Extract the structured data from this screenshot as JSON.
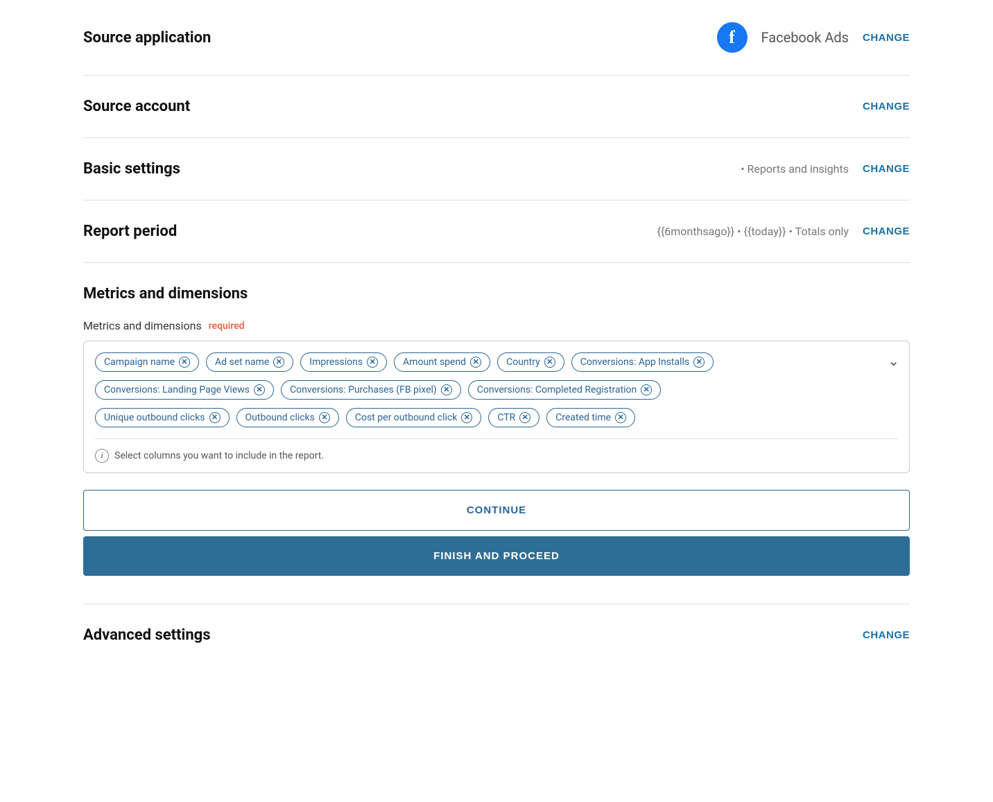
{
  "sourceApplication": {
    "title": "Source application",
    "appName": "Facebook Ads",
    "changeBtnLabel": "CHANGE",
    "fbIconLetter": "f"
  },
  "sourceAccount": {
    "title": "Source account",
    "changeBtnLabel": "CHANGE"
  },
  "basicSettings": {
    "title": "Basic settings",
    "meta": "• Reports and insights",
    "changeBtnLabel": "CHANGE"
  },
  "reportPeriod": {
    "title": "Report period",
    "meta": "{{6monthsago}} • {{today}} • Totals only",
    "changeBtnLabel": "CHANGE"
  },
  "metricsSection": {
    "title": "Metrics and dimensions",
    "label": "Metrics and dimensions",
    "requiredLabel": "required",
    "hintText": "Select columns you want to include in the report.",
    "chevronLabel": "▾",
    "tags": [
      [
        {
          "label": "Campaign name"
        },
        {
          "label": "Ad set name"
        },
        {
          "label": "Impressions"
        },
        {
          "label": "Amount spend"
        },
        {
          "label": "Country"
        },
        {
          "label": "Conversions: App Installs"
        }
      ],
      [
        {
          "label": "Conversions: Landing Page Views"
        },
        {
          "label": "Conversions: Purchases (FB pixel)"
        },
        {
          "label": "Conversions: Completed Registration"
        }
      ],
      [
        {
          "label": "Unique outbound clicks"
        },
        {
          "label": "Outbound clicks"
        },
        {
          "label": "Cost per outbound click"
        },
        {
          "label": "CTR"
        },
        {
          "label": "Created time"
        }
      ]
    ]
  },
  "buttons": {
    "continue": "CONTINUE",
    "finish": "FINISH AND PROCEED"
  },
  "advancedSettings": {
    "title": "Advanced settings",
    "changeBtnLabel": "CHANGE"
  }
}
